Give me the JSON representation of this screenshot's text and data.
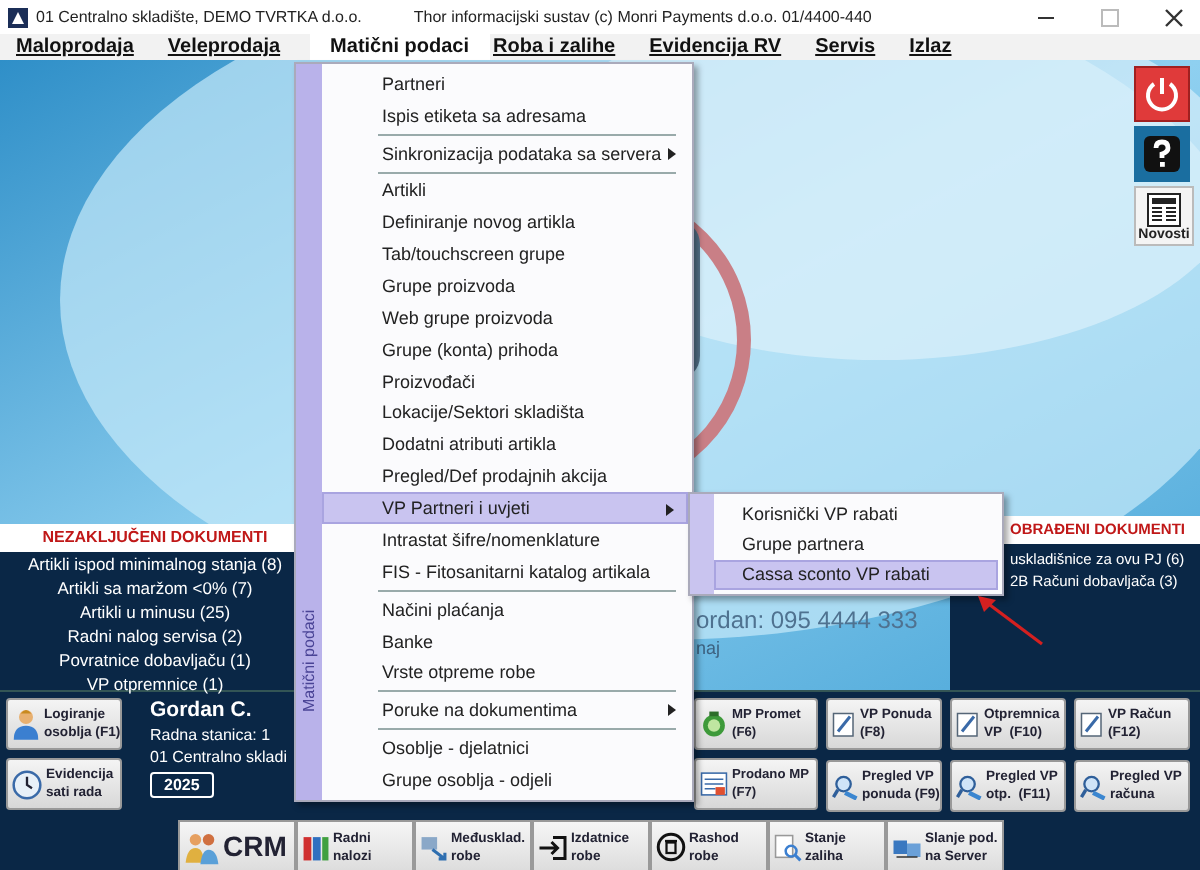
{
  "window": {
    "subtitle": "01 Centralno skladište, DEMO TVRTKA d.o.o.",
    "title": "Thor informacijski sustav (c) Monri Payments d.o.o. 01/4400-440"
  },
  "menu_bar": [
    {
      "label": "Maloprodaja",
      "selected": false
    },
    {
      "label": "Veleprodaja",
      "selected": false
    },
    {
      "label": "Matični podaci",
      "selected": true
    },
    {
      "label": "Roba i zalihe",
      "selected": false
    },
    {
      "label": "Evidencija RV",
      "selected": false
    },
    {
      "label": "Servis",
      "selected": false
    },
    {
      "label": "Izlaz",
      "selected": false
    }
  ],
  "side_buttons": [
    {
      "kind": "power"
    },
    {
      "kind": "help"
    },
    {
      "kind": "news",
      "label": "Novosti"
    }
  ],
  "background_texts": [
    "ordan: 095 4444 333",
    "naj"
  ],
  "left_panel": {
    "title": "NEZAKLJUČENI DOKUMENTI",
    "items": [
      "Artikli ispod minimalnog stanja (8)",
      "Artikli sa maržom <0% (7)",
      "Artikli u minusu (25)",
      "Radni nalog servisa (2)",
      "Povratnice dobavljaču (1)",
      "VP otpremnice (1)"
    ]
  },
  "right_panel": {
    "title": "OBRAĐENI DOKUMENTI",
    "items": [
      "uskladišnice za ovu PJ (6)",
      "2B Računi dobavljača (3)"
    ]
  },
  "user_buttons": [
    {
      "kind": "person",
      "lines": [
        "Logiranje",
        "osoblja (F1)"
      ]
    },
    {
      "kind": "clock",
      "lines": [
        "Evidencija",
        "sati rada"
      ]
    }
  ],
  "user": {
    "name": "Gordan C.",
    "workstation": "Radna stanica: 1",
    "warehouse": "01 Centralno skladi",
    "year": "2025"
  },
  "mp_buttons": [
    {
      "kind": "money",
      "lines": [
        "MP Promet",
        "(F6)"
      ]
    },
    {
      "kind": "list",
      "lines": [
        "Prodano MP",
        "(F7)"
      ]
    }
  ],
  "vp_buttons": [
    {
      "kind": "doc",
      "lines": [
        "VP Ponuda",
        "(F8)"
      ]
    },
    {
      "kind": "doc",
      "lines": [
        "Otpremnica",
        "VP  (F10)"
      ]
    },
    {
      "kind": "doc",
      "lines": [
        "VP Račun",
        "(F12)"
      ]
    },
    {
      "kind": "search",
      "lines": [
        "Pregled VP",
        "ponuda (F9)"
      ]
    },
    {
      "kind": "search",
      "lines": [
        "Pregled VP",
        "otp.  (F11)"
      ]
    },
    {
      "kind": "search",
      "lines": [
        "Pregled VP",
        "računa"
      ]
    }
  ],
  "toolbar": [
    {
      "kind": "crm",
      "lines": [
        "CRM"
      ]
    },
    {
      "kind": "binders",
      "lines": [
        "Radni",
        "nalozi"
      ]
    },
    {
      "kind": "transfer",
      "lines": [
        "Međusklad.",
        "robe"
      ]
    },
    {
      "kind": "exit",
      "lines": [
        "Izdatnice",
        "robe"
      ]
    },
    {
      "kind": "trash",
      "lines": [
        "Rashod",
        "robe"
      ]
    },
    {
      "kind": "stock",
      "lines": [
        "Stanje",
        "zaliha"
      ]
    },
    {
      "kind": "server",
      "lines": [
        "Slanje pod.",
        "na Server"
      ]
    }
  ],
  "dropdown": {
    "caption": "Matični podaci",
    "items": [
      {
        "kind": "item",
        "label": "Partneri",
        "submenu": false,
        "selected": false
      },
      {
        "kind": "item",
        "label": "Ispis etiketa sa adresama",
        "submenu": false,
        "selected": false
      },
      {
        "kind": "separator"
      },
      {
        "kind": "item",
        "label": "Sinkronizacija podataka sa servera",
        "submenu": true,
        "selected": false
      },
      {
        "kind": "separator"
      },
      {
        "kind": "item",
        "label": "Artikli",
        "submenu": false,
        "selected": false
      },
      {
        "kind": "item",
        "label": "Definiranje novog artikla",
        "submenu": false,
        "selected": false
      },
      {
        "kind": "item",
        "label": "Tab/touchscreen grupe",
        "submenu": false,
        "selected": false
      },
      {
        "kind": "item",
        "label": "Grupe proizvoda",
        "submenu": false,
        "selected": false
      },
      {
        "kind": "item",
        "label": "Web grupe proizvoda",
        "submenu": false,
        "selected": false
      },
      {
        "kind": "item",
        "label": "Grupe (konta) prihoda",
        "submenu": false,
        "selected": false
      },
      {
        "kind": "item",
        "label": "Proizvođači",
        "submenu": false,
        "selected": false
      },
      {
        "kind": "item",
        "label": "Lokacije/Sektori skladišta",
        "submenu": false,
        "selected": false
      },
      {
        "kind": "item",
        "label": "Dodatni atributi artikla",
        "submenu": false,
        "selected": false
      },
      {
        "kind": "item",
        "label": "Pregled/Def prodajnih akcija",
        "submenu": false,
        "selected": false
      },
      {
        "kind": "item",
        "label": "VP Partneri i uvjeti",
        "submenu": true,
        "selected": true
      },
      {
        "kind": "item",
        "label": "Intrastat šifre/nomenklature",
        "submenu": false,
        "selected": false
      },
      {
        "kind": "item",
        "label": "FIS - Fitosanitarni katalog artikala",
        "submenu": false,
        "selected": false
      },
      {
        "kind": "separator"
      },
      {
        "kind": "item",
        "label": "Načini plaćanja",
        "submenu": false,
        "selected": false
      },
      {
        "kind": "item",
        "label": "Banke",
        "submenu": false,
        "selected": false
      },
      {
        "kind": "item",
        "label": "Vrste otpreme robe",
        "submenu": false,
        "selected": false
      },
      {
        "kind": "separator"
      },
      {
        "kind": "item",
        "label": "Poruke na dokumentima",
        "submenu": true,
        "selected": false
      },
      {
        "kind": "separator"
      },
      {
        "kind": "item",
        "label": "Osoblje - djelatnici",
        "submenu": false,
        "selected": false
      },
      {
        "kind": "item",
        "label": "Grupe osoblja - odjeli",
        "submenu": false,
        "selected": false
      }
    ]
  },
  "submenu": {
    "items": [
      {
        "label": "Korisnički VP rabati",
        "selected": false
      },
      {
        "label": "Grupe partnera",
        "selected": false
      },
      {
        "label": "Cassa sconto VP rabati",
        "selected": true
      }
    ]
  }
}
